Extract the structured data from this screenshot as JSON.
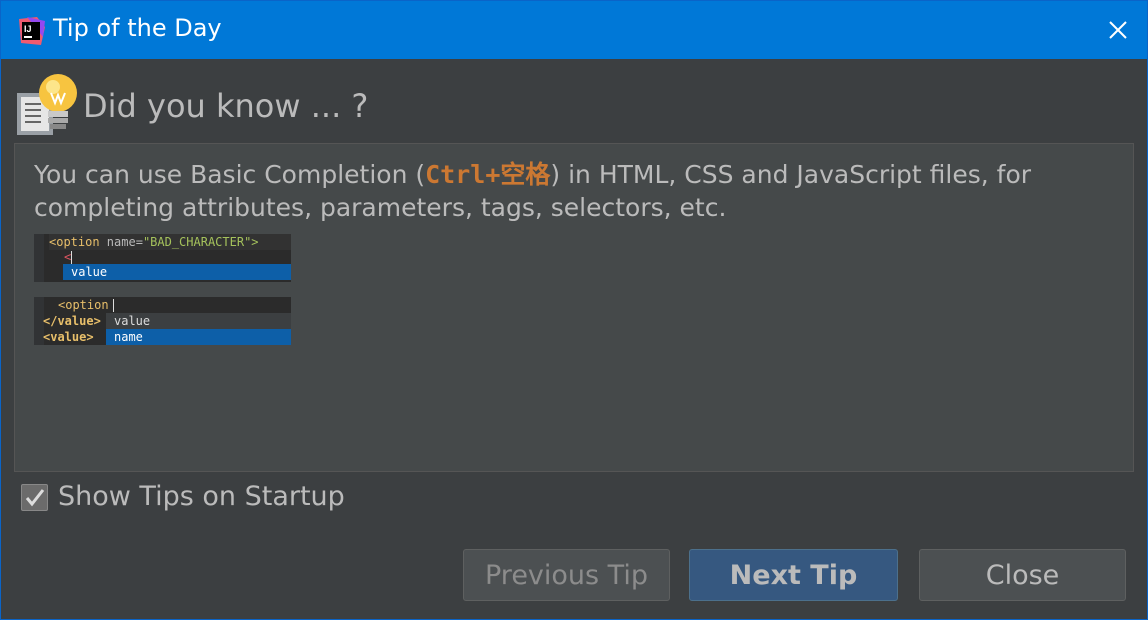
{
  "window": {
    "title": "Tip of the Day"
  },
  "header": {
    "heading": "Did you know ... ?"
  },
  "tip": {
    "text_before": "You can use Basic Completion (",
    "shortcut": "Ctrl+空格",
    "text_after": ") in HTML, CSS and JavaScript files, for completing attributes, parameters, tags, selectors, etc."
  },
  "example1": {
    "line1_tag": "<option",
    "line1_attr": " name=",
    "line1_value": "\"BAD_CHARACTER\">",
    "line2": "<",
    "suggestion": "value"
  },
  "example2": {
    "line1": "<option",
    "line2": "</value>",
    "line3": "<value>",
    "suggestion_1": "value",
    "suggestion_2": "name"
  },
  "startup_checkbox": {
    "label": "Show Tips on Startup",
    "checked": true
  },
  "buttons": {
    "previous": "Previous Tip",
    "next": "Next Tip",
    "close": "Close"
  },
  "colors": {
    "titlebar": "#0078d7",
    "background": "#3c3f41",
    "shortcut": "#cc7832",
    "selection": "#0d5fa8"
  },
  "icons": {
    "app": "intellij-icon",
    "close": "close-icon",
    "bulb": "lightbulb-icon",
    "checkbox": "checkmark-icon"
  }
}
